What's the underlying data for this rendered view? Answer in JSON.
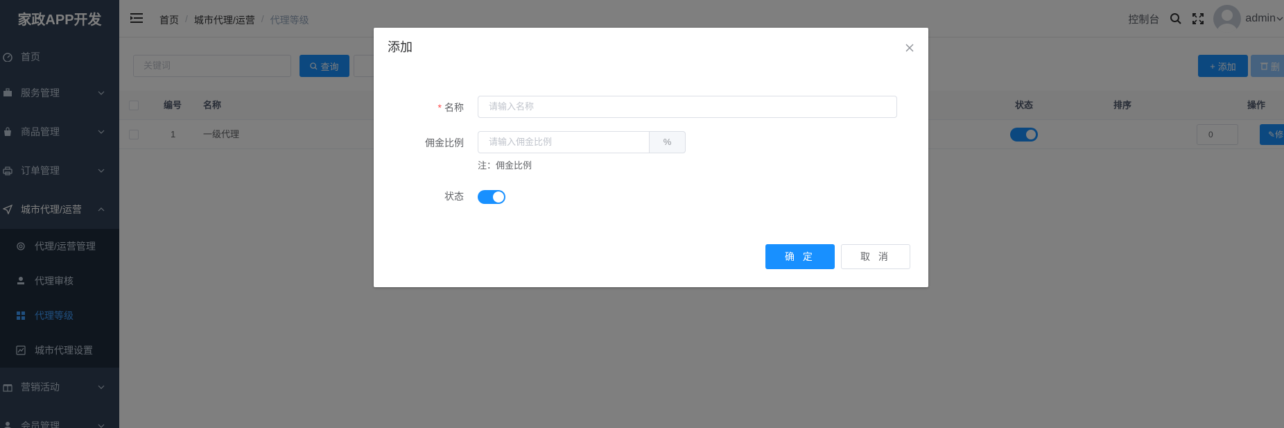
{
  "app": {
    "logo": "家政APP开发"
  },
  "sidebar": {
    "items": [
      {
        "label": "首页",
        "icon": "dashboard-icon"
      },
      {
        "label": "服务管理",
        "icon": "briefcase-icon"
      },
      {
        "label": "商品管理",
        "icon": "bag-icon"
      },
      {
        "label": "订单管理",
        "icon": "printer-icon"
      },
      {
        "label": "城市代理/运营",
        "icon": "send-icon"
      }
    ],
    "submenu": [
      {
        "label": "代理/运营管理",
        "icon": "settings-icon"
      },
      {
        "label": "代理审核",
        "icon": "stamp-icon"
      },
      {
        "label": "代理等级",
        "icon": "grid-icon"
      },
      {
        "label": "城市代理设置",
        "icon": "chart-icon"
      }
    ],
    "after": [
      {
        "label": "营销活动",
        "icon": "gift-icon"
      },
      {
        "label": "会员管理",
        "icon": "user-icon"
      }
    ]
  },
  "header": {
    "breadcrumb": [
      "首页",
      "城市代理/运营",
      "代理等级"
    ],
    "console": "控制台",
    "user": "admin"
  },
  "toolbar": {
    "search_placeholder": "关键词",
    "query_label": "查询",
    "add_label": "添加",
    "delete_label": "删"
  },
  "table": {
    "headers": {
      "no": "编号",
      "name": "名称",
      "status": "状态",
      "sort": "排序",
      "op": "操作"
    },
    "rows": [
      {
        "no": "1",
        "name": "一级代理",
        "status": true,
        "sort": "0",
        "edit": "修"
      }
    ]
  },
  "dialog": {
    "title": "添加",
    "name_label": "名称",
    "name_placeholder": "请输入名称",
    "commission_label": "佣金比例",
    "commission_placeholder": "请输入佣金比例",
    "commission_suffix": "%",
    "commission_hint": "注：佣金比例",
    "status_label": "状态",
    "status_on": true,
    "ok_label": "确 定",
    "cancel_label": "取 消"
  },
  "colors": {
    "primary": "#1890ff",
    "sidebar_bg": "#304156",
    "active": "#409eff"
  }
}
